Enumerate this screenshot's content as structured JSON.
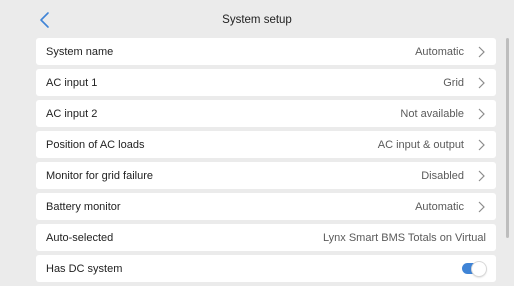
{
  "header": {
    "title": "System setup",
    "back_icon": "chevron-left-icon",
    "accent": "#3f84d6"
  },
  "rows": [
    {
      "label": "System name",
      "value": "Automatic",
      "chevron": true
    },
    {
      "label": "AC input 1",
      "value": "Grid",
      "chevron": true
    },
    {
      "label": "AC input 2",
      "value": "Not available",
      "chevron": true
    },
    {
      "label": "Position of AC loads",
      "value": "AC input & output",
      "chevron": true
    },
    {
      "label": "Monitor for grid failure",
      "value": "Disabled",
      "chevron": true
    },
    {
      "label": "Battery monitor",
      "value": "Automatic",
      "chevron": true
    },
    {
      "label": "Auto-selected",
      "value": "Lynx Smart BMS Totals on Virtual",
      "chevron": false
    },
    {
      "label": "Has DC system",
      "toggle": true,
      "toggle_on": true
    }
  ]
}
